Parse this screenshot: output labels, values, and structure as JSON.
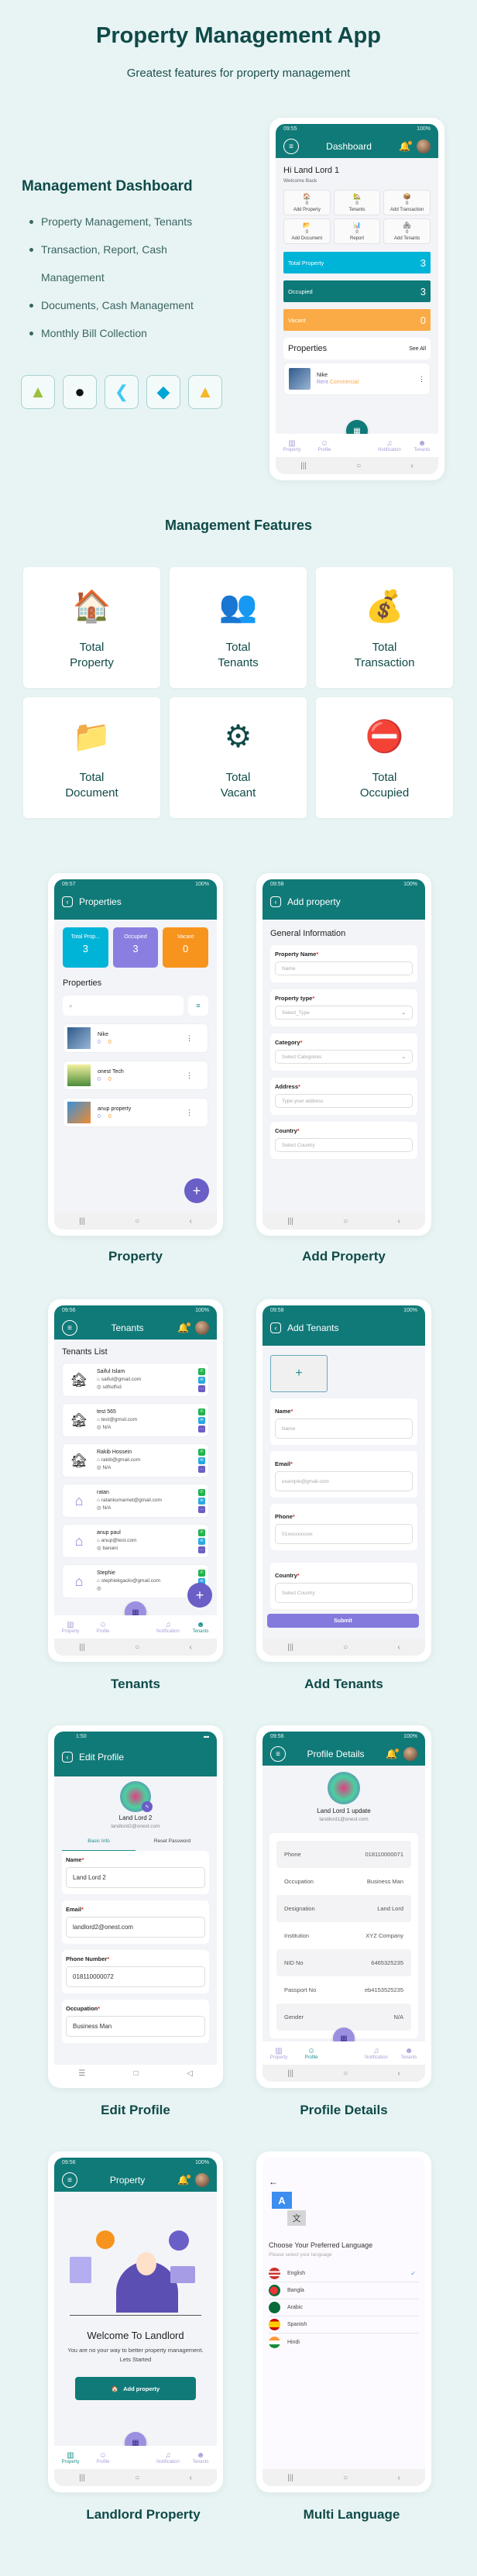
{
  "hero": {
    "title": "Property Management App",
    "subtitle": "Greatest features for property management"
  },
  "dashboard_section": {
    "title": "Management Dashboard",
    "bullets": [
      "Property Management, Tenants",
      "Transaction, Report, Cash Management",
      "Documents, Cash Management",
      "Monthly Bill Collection"
    ],
    "tech_icons": [
      "android-icon",
      "apple-icon",
      "flutter-icon",
      "dart-icon",
      "firebase-icon"
    ]
  },
  "dashboard_phone": {
    "status_time": "09:55",
    "status_right": "100%",
    "title": "Dashboard",
    "greeting": "Hi Land Lord 1",
    "welcome": "Welcome Back",
    "tiles": [
      {
        "count": "0",
        "label": "Add Property"
      },
      {
        "count": "0",
        "label": "Tenants"
      },
      {
        "count": "0",
        "label": "Add Transaction"
      },
      {
        "count": "0",
        "label": "Add Document"
      },
      {
        "count": "0",
        "label": "Report"
      },
      {
        "count": "0",
        "label": "Add Tenants"
      }
    ],
    "stats": [
      {
        "label": "Total Property",
        "value": "3",
        "color": "#00b4d8"
      },
      {
        "label": "Occupied",
        "value": "3",
        "color": "#0d7a78"
      },
      {
        "label": "Vacant",
        "value": "0",
        "color": "#fbab45"
      }
    ],
    "properties_title": "Properties",
    "see_all": "See All",
    "property_item": {
      "name": "Nike",
      "tag1": "Rent",
      "tag2": "Commercial"
    }
  },
  "nav": {
    "items": [
      "Property",
      "Profile",
      "Notification",
      "Tenants"
    ]
  },
  "features": {
    "title": "Management Features",
    "cards": [
      {
        "line1": "Total",
        "line2": "Property",
        "icon": "🏠"
      },
      {
        "line1": "Total",
        "line2": "Tenants",
        "icon": "👥"
      },
      {
        "line1": "Total",
        "line2": "Transaction",
        "icon": "💰"
      },
      {
        "line1": "Total",
        "line2": "Document",
        "icon": "📁"
      },
      {
        "line1": "Total",
        "line2": "Vacant",
        "icon": "⚙"
      },
      {
        "line1": "Total",
        "line2": "Occupied",
        "icon": "⛔"
      }
    ]
  },
  "properties_phone": {
    "status_time": "09:57",
    "status_right": "100%",
    "title": "Properties",
    "stats": [
      {
        "label": "Total Prop...",
        "value": "3",
        "color": "#00b4d8"
      },
      {
        "label": "Occupied",
        "value": "3",
        "color": "#8a7fe0"
      },
      {
        "label": "Vacant",
        "value": "0",
        "color": "#f7941d"
      }
    ],
    "list_title": "Properties",
    "items": [
      {
        "name": "Nike",
        "a": "0",
        "b": "0"
      },
      {
        "name": "onest Tech",
        "a": "0",
        "b": "0"
      },
      {
        "name": "anup property",
        "a": "0",
        "b": "0"
      }
    ],
    "caption": "Property"
  },
  "add_property_phone": {
    "status_time": "09:58",
    "status_right": "100%",
    "title": "Add property",
    "section": "General Information",
    "fields": [
      {
        "label": "Property Name",
        "placeholder": "Name",
        "dropdown": false
      },
      {
        "label": "Property type",
        "placeholder": "Select_Type",
        "dropdown": true
      },
      {
        "label": "Category",
        "placeholder": "Select Categories",
        "dropdown": true
      },
      {
        "label": "Address",
        "placeholder": "Type your address",
        "dropdown": false
      },
      {
        "label": "Country",
        "placeholder": "Select Country",
        "dropdown": false
      }
    ],
    "caption": "Add Property"
  },
  "tenants_phone": {
    "status_time": "09:56",
    "status_right": "100%",
    "title": "Tenants",
    "list_title": "Tenants List",
    "items": [
      {
        "name": "Saiful Islam",
        "email": "saiful@gmail.com",
        "address": "sdfsdfsd"
      },
      {
        "name": "test 565",
        "email": "test@gmsil.com",
        "address": "N/A"
      },
      {
        "name": "Rakib Hossein",
        "email": "rakib@gmail.com",
        "address": "N/A"
      },
      {
        "name": "ratan",
        "email": "ratankumarnet@gmail.com",
        "address": "N/A"
      },
      {
        "name": "anup paul",
        "email": "anup@test.com",
        "address": "banani"
      },
      {
        "name": "Stephie",
        "email": "stephiekgaolo@gmail.com",
        "address": ""
      }
    ],
    "caption": "Tenants"
  },
  "add_tenants_phone": {
    "status_time": "09:58",
    "status_right": "100%",
    "title": "Add Tenants",
    "fields": [
      {
        "label": "Name",
        "placeholder": "Name"
      },
      {
        "label": "Email",
        "placeholder": "example@gmail.com"
      },
      {
        "label": "Phone",
        "placeholder": "01xxxxxxxxxx"
      },
      {
        "label": "Country",
        "placeholder": "Select Country"
      }
    ],
    "submit": "Submit",
    "caption": "Add Tenants"
  },
  "edit_profile_phone": {
    "status_time": "1:50",
    "title": "Edit Profile",
    "name": "Land Lord 2",
    "email": "landlord2@onest.com",
    "tabs": [
      "Basic Info",
      "Reset Password"
    ],
    "fields": [
      {
        "label": "Name",
        "value": "Land Lord 2"
      },
      {
        "label": "Email",
        "value": "landlord2@onest.com"
      },
      {
        "label": "Phone Number",
        "value": "018110000072"
      },
      {
        "label": "Occupation",
        "value": "Business Man"
      }
    ],
    "caption": "Edit Profile"
  },
  "profile_details_phone": {
    "status_time": "09:56",
    "status_right": "100%",
    "title": "Profile Details",
    "name": "Land Lord 1 update",
    "email": "landlord1@onest.com",
    "rows": [
      {
        "k": "Phone",
        "v": "018110000071"
      },
      {
        "k": "Occupation",
        "v": "Business Man"
      },
      {
        "k": "Designation",
        "v": "Land Lord"
      },
      {
        "k": "Institution",
        "v": "XYZ Company"
      },
      {
        "k": "NID No",
        "v": "6465325235"
      },
      {
        "k": "Passport No",
        "v": "eb4153525235"
      },
      {
        "k": "Gender",
        "v": "N/A"
      }
    ],
    "caption": "Profile Details"
  },
  "landlord_phone": {
    "status_time": "09:56",
    "status_right": "100%",
    "title": "Property",
    "welcome": "Welcome To Landlord",
    "desc": "You are no your way to better property management. Lets Started",
    "button": "Add property",
    "caption": "Landlord Property"
  },
  "language_phone": {
    "title": "Choose Your Preferred Language",
    "subtitle": "Please select your language",
    "languages": [
      {
        "name": "English",
        "selected": true
      },
      {
        "name": "Bangla",
        "selected": false
      },
      {
        "name": "Arabic",
        "selected": false
      },
      {
        "name": "Spanish",
        "selected": false
      },
      {
        "name": "Hindi",
        "selected": false
      }
    ],
    "caption": "Multi Language"
  }
}
